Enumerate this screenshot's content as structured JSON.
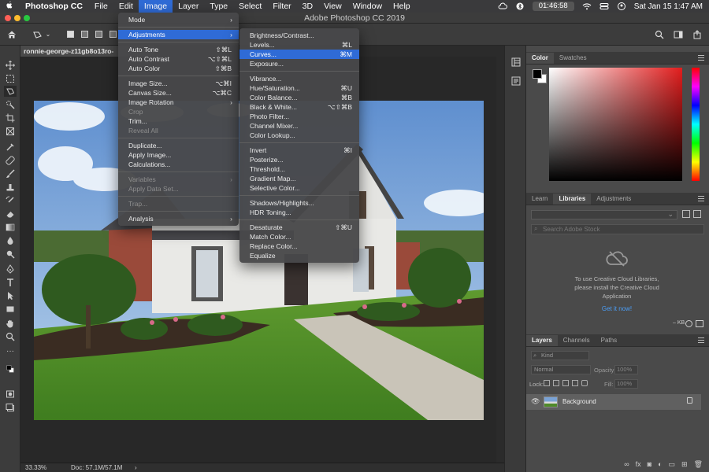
{
  "menubar": {
    "app_name": "Photoshop CC",
    "items": [
      "File",
      "Edit",
      "Image",
      "Layer",
      "Type",
      "Select",
      "Filter",
      "3D",
      "View",
      "Window",
      "Help"
    ],
    "active_item": "Image",
    "timer": "01:46:58",
    "clock": "Sat Jan 15  1:47 AM"
  },
  "window": {
    "title": "Adobe Photoshop CC 2019"
  },
  "document": {
    "tab_label": "ronnie-george-z11gb8o13ro-",
    "zoom": "33.33%",
    "doc_size": "Doc: 57.1M/57.1M"
  },
  "image_menu": {
    "items": [
      {
        "label": "Mode",
        "submenu": true
      },
      {
        "sep": true
      },
      {
        "label": "Adjustments",
        "submenu": true,
        "highlighted": true
      },
      {
        "sep": true
      },
      {
        "label": "Auto Tone",
        "shortcut": "⇧⌘L"
      },
      {
        "label": "Auto Contrast",
        "shortcut": "⌥⇧⌘L"
      },
      {
        "label": "Auto Color",
        "shortcut": "⇧⌘B"
      },
      {
        "sep": true
      },
      {
        "label": "Image Size...",
        "shortcut": "⌥⌘I"
      },
      {
        "label": "Canvas Size...",
        "shortcut": "⌥⌘C"
      },
      {
        "label": "Image Rotation",
        "submenu": true
      },
      {
        "label": "Crop",
        "disabled": true
      },
      {
        "label": "Trim..."
      },
      {
        "label": "Reveal All",
        "disabled": true
      },
      {
        "sep": true
      },
      {
        "label": "Duplicate..."
      },
      {
        "label": "Apply Image..."
      },
      {
        "label": "Calculations..."
      },
      {
        "sep": true
      },
      {
        "label": "Variables",
        "submenu": true,
        "disabled": true
      },
      {
        "label": "Apply Data Set...",
        "disabled": true
      },
      {
        "sep": true
      },
      {
        "label": "Trap...",
        "disabled": true
      },
      {
        "sep": true
      },
      {
        "label": "Analysis",
        "submenu": true
      }
    ]
  },
  "adjustments_menu": {
    "items": [
      {
        "label": "Brightness/Contrast..."
      },
      {
        "label": "Levels...",
        "shortcut": "⌘L"
      },
      {
        "label": "Curves...",
        "shortcut": "⌘M",
        "highlighted": true
      },
      {
        "label": "Exposure..."
      },
      {
        "sep": true
      },
      {
        "label": "Vibrance..."
      },
      {
        "label": "Hue/Saturation...",
        "shortcut": "⌘U"
      },
      {
        "label": "Color Balance...",
        "shortcut": "⌘B"
      },
      {
        "label": "Black & White...",
        "shortcut": "⌥⇧⌘B"
      },
      {
        "label": "Photo Filter..."
      },
      {
        "label": "Channel Mixer..."
      },
      {
        "label": "Color Lookup..."
      },
      {
        "sep": true
      },
      {
        "label": "Invert",
        "shortcut": "⌘I"
      },
      {
        "label": "Posterize..."
      },
      {
        "label": "Threshold..."
      },
      {
        "label": "Gradient Map..."
      },
      {
        "label": "Selective Color..."
      },
      {
        "sep": true
      },
      {
        "label": "Shadows/Highlights..."
      },
      {
        "label": "HDR Toning..."
      },
      {
        "sep": true
      },
      {
        "label": "Desaturate",
        "shortcut": "⇧⌘U"
      },
      {
        "label": "Match Color..."
      },
      {
        "label": "Replace Color..."
      },
      {
        "label": "Equalize"
      }
    ]
  },
  "color_panel": {
    "tabs": [
      "Color",
      "Swatches"
    ],
    "active_tab": "Color"
  },
  "libraries_panel": {
    "tabs": [
      "Learn",
      "Libraries",
      "Adjustments"
    ],
    "active_tab": "Libraries",
    "search_placeholder": "Search Adobe Stock",
    "message": "To use Creative Cloud Libraries, please install the Creative Cloud Application",
    "link": "Get it now!",
    "footer": "– KB"
  },
  "layers_panel": {
    "tabs": [
      "Layers",
      "Channels",
      "Paths"
    ],
    "active_tab": "Layers",
    "filter_kind": "Kind",
    "blend_mode": "Normal",
    "opacity_label": "Opacity:",
    "opacity_value": "100%",
    "lock_label": "Lock:",
    "fill_label": "Fill:",
    "fill_value": "100%",
    "layers": [
      {
        "name": "Background",
        "visible": true,
        "locked": true
      }
    ]
  },
  "colors": {
    "accent": "#2f6bd6",
    "menubar_bg": "#3a3a3c",
    "panel_bg": "#4a4a4a",
    "canvas_bg": "#282828"
  }
}
